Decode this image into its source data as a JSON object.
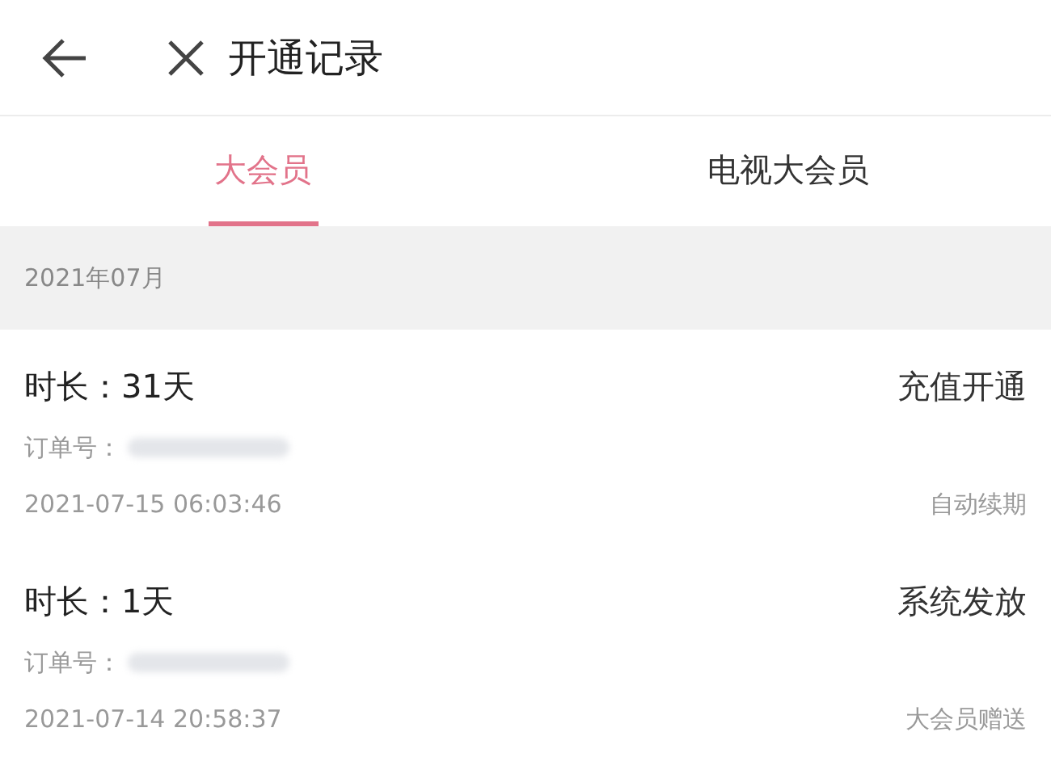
{
  "header": {
    "title": "开通记录"
  },
  "tabs": [
    {
      "label": "大会员",
      "selected": true
    },
    {
      "label": "电视大会员",
      "selected": false
    }
  ],
  "section": {
    "label": "2021年07月"
  },
  "records": [
    {
      "duration": "时长：31天",
      "source": "充值开通",
      "order_label": "订单号：",
      "time": "2021-07-15 06:03:46",
      "note": "自动续期"
    },
    {
      "duration": "时长：1天",
      "source": "系统发放",
      "order_label": "订单号：",
      "time": "2021-07-14 20:58:37",
      "note": "大会员赠送"
    }
  ]
}
